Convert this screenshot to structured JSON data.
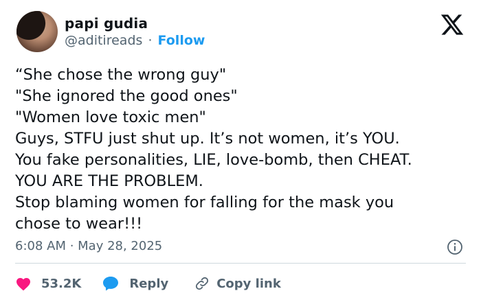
{
  "author": {
    "name": "papi gudia",
    "handle": "@aditireads",
    "separator": "·",
    "follow_label": "Follow"
  },
  "tweet": {
    "lines": [
      "“She chose the wrong guy\"",
      "\"She ignored the good ones\"",
      "\"Women love toxic men\"",
      "Guys, STFU just shut up. It’s not women, it’s YOU.",
      "You fake personalities, LIE, love-bomb, then CHEAT.",
      "YOU ARE THE PROBLEM.",
      "Stop blaming women for falling for the mask you",
      "chose to wear!!!"
    ],
    "timestamp": "6:08 AM · May 28, 2025"
  },
  "actions": {
    "likes_count": "53.2K",
    "reply_label": "Reply",
    "copy_link_label": "Copy link"
  },
  "icons": {
    "logo": "x-logo-icon",
    "info": "info-icon",
    "like": "heart-icon",
    "reply": "speech-bubble-icon",
    "copy": "link-icon"
  },
  "colors": {
    "accent": "#1d9bf0",
    "heart": "#f91880",
    "secondary_text": "#536471",
    "primary_text": "#0f1419"
  }
}
